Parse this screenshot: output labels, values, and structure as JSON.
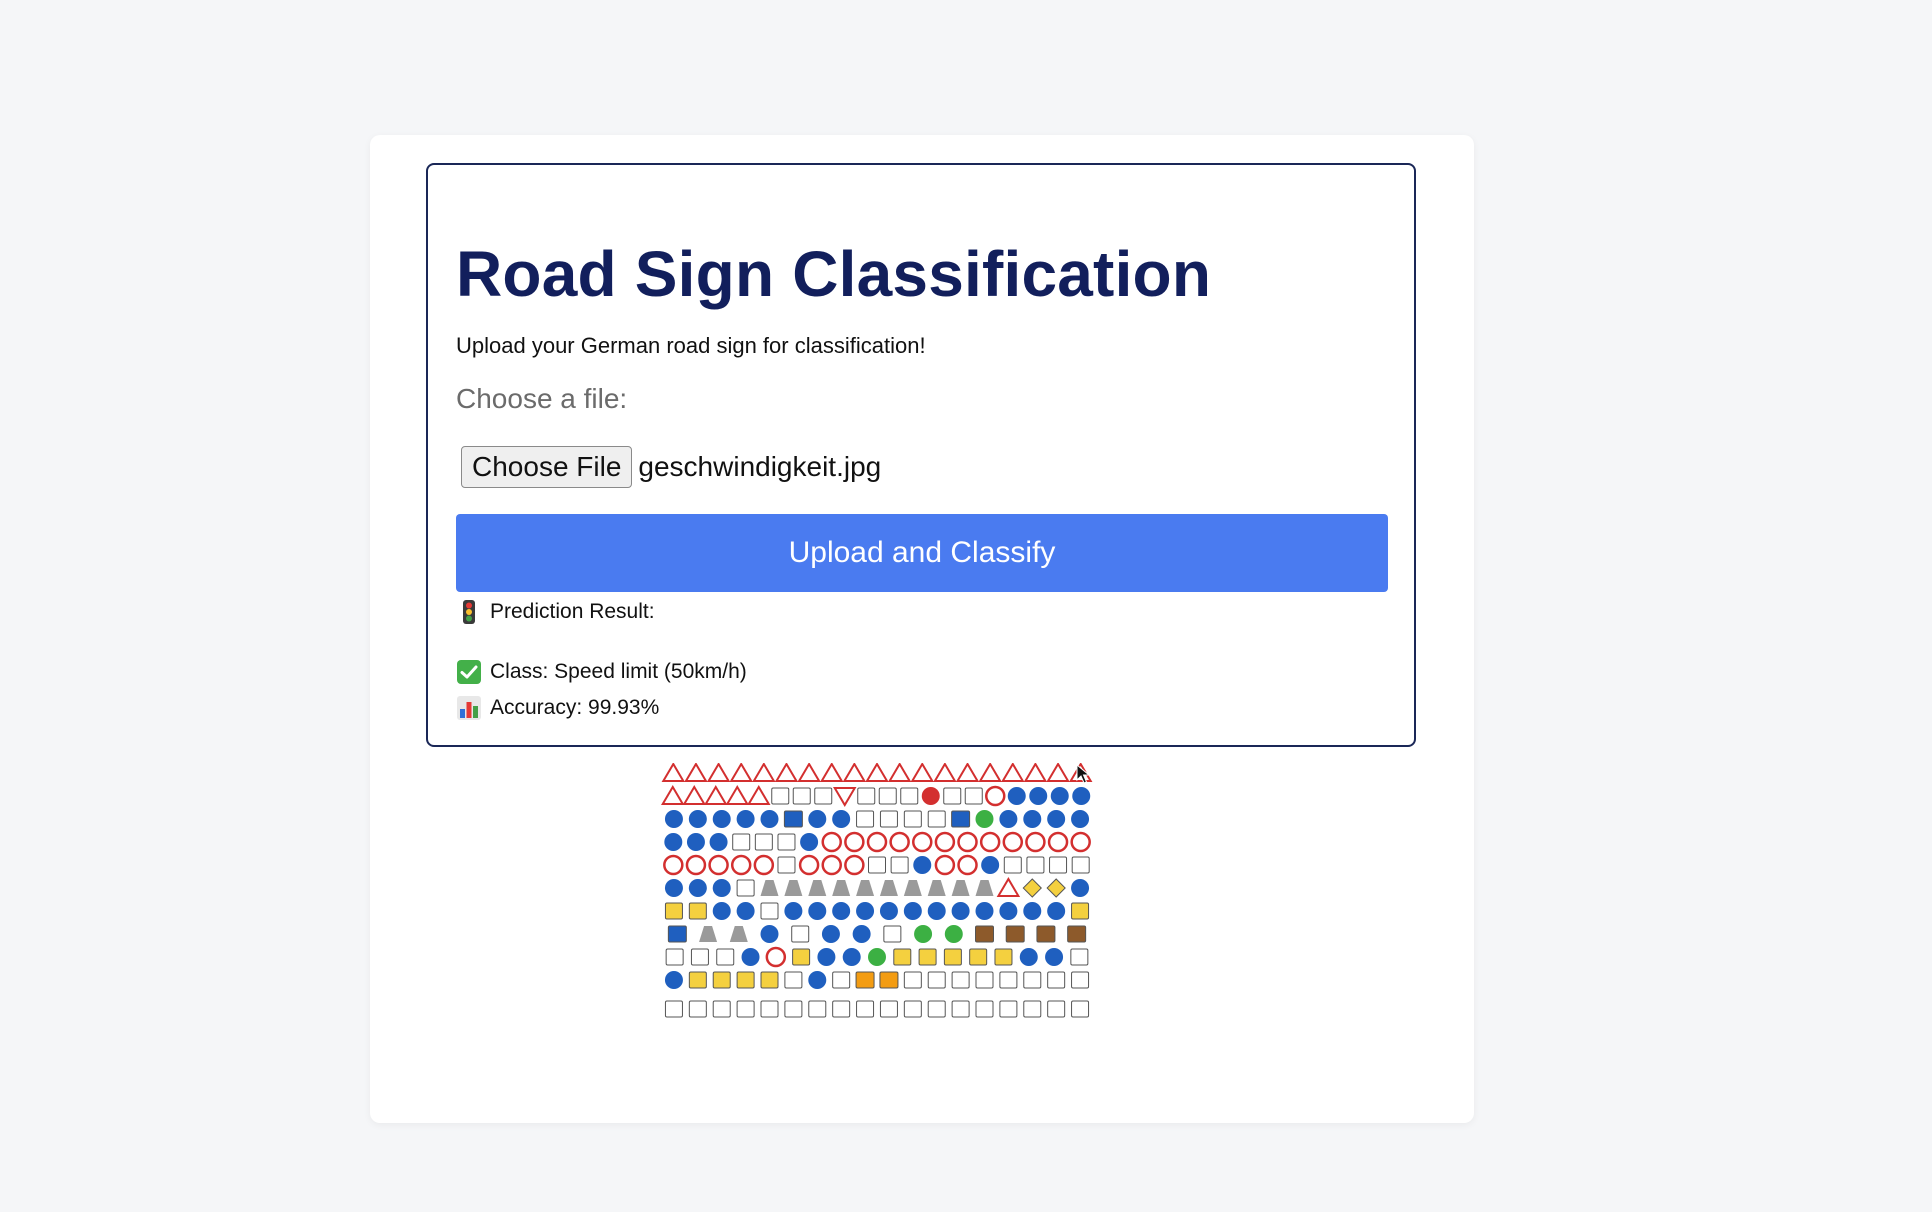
{
  "header": {
    "title": "Road Sign Classification",
    "subtitle": "Upload your German road sign for classification!"
  },
  "upload": {
    "file_label": "Choose a file:",
    "choose_button": "Choose File",
    "file_name": "geschwindigkeit.jpg",
    "submit_button": "Upload and Classify"
  },
  "result": {
    "heading": "Prediction Result:",
    "heading_icon": "traffic-light-icon",
    "class_text": "Class: Speed limit (50km/h)",
    "class_icon": "check-mark-icon",
    "accuracy_text": "Accuracy: 99.93%",
    "accuracy_icon": "bar-chart-icon"
  },
  "colors": {
    "title": "#121f5c",
    "panel_border": "#1a2757",
    "button": "#4a7bf0",
    "background": "#f5f6f8"
  },
  "image": {
    "description_icon": "german-road-signs-collage"
  }
}
